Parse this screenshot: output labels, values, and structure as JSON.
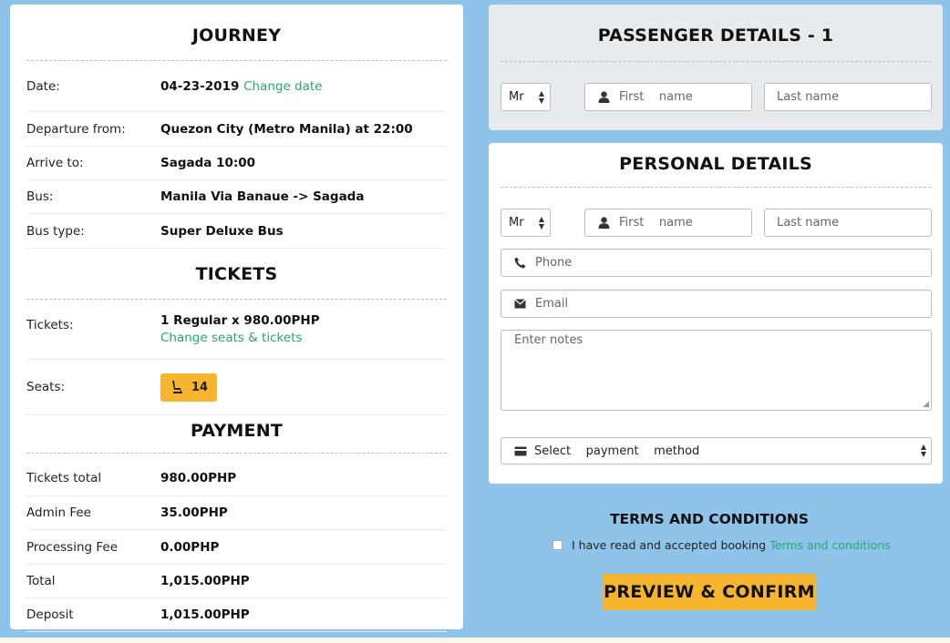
{
  "journey": {
    "title": "JOURNEY",
    "rows": [
      {
        "label": "Date:",
        "value": "04-23-2019",
        "link": "Change date"
      },
      {
        "label": "Departure from:",
        "value": "Quezon City (Metro Manila) at 22:00"
      },
      {
        "label": "Arrive to:",
        "value": "Sagada 10:00"
      },
      {
        "label": "Bus:",
        "value": "Manila Via Banaue -> Sagada"
      },
      {
        "label": "Bus type:",
        "value": "Super Deluxe Bus"
      }
    ]
  },
  "tickets": {
    "title": "TICKETS",
    "tickets_label": "Tickets:",
    "tickets_value": "1 Regular x 980.00PHP",
    "change_link": "Change seats & tickets",
    "seats_label": "Seats:",
    "seat_number": "14"
  },
  "payment": {
    "title": "PAYMENT",
    "rows": [
      {
        "label": "Tickets total",
        "value": "980.00PHP"
      },
      {
        "label": "Admin Fee",
        "value": "35.00PHP"
      },
      {
        "label": "Processing Fee",
        "value": "0.00PHP"
      },
      {
        "label": "Total",
        "value": "1,015.00PHP"
      },
      {
        "label": "Deposit",
        "value": "1,015.00PHP"
      }
    ]
  },
  "passenger": {
    "title": "PASSENGER DETAILS - 1",
    "salutation": "Mr",
    "first_name_placeholder": "First    name",
    "last_name_placeholder": "Last name"
  },
  "personal": {
    "title": "PERSONAL DETAILS",
    "salutation": "Mr",
    "first_name_placeholder": "First    name",
    "last_name_placeholder": "Last name",
    "phone_placeholder": "Phone",
    "email_placeholder": "Email",
    "notes_placeholder": "Enter notes",
    "payment_method": "Select    payment    method"
  },
  "terms": {
    "title": "TERMS AND CONDITIONS",
    "text": "I have read and accepted booking",
    "link": "Terms and conditions"
  },
  "confirm_label": "PREVIEW & CONFIRM",
  "colors": {
    "background": "#8ec4ea",
    "accent": "#f6b52e",
    "link": "#2aa572"
  }
}
